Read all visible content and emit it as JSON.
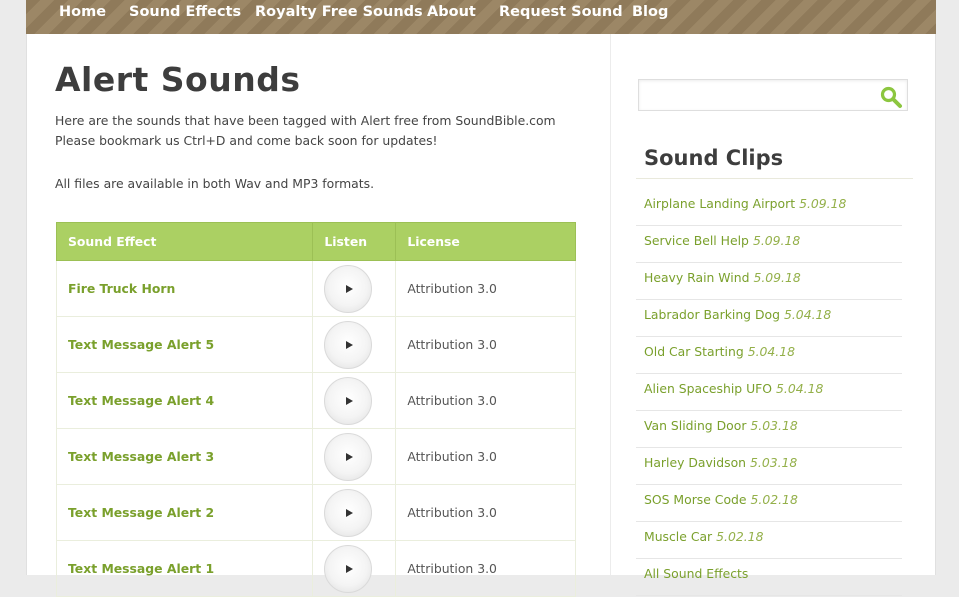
{
  "nav": {
    "items": [
      "Home",
      "Sound Effects",
      "Royalty Free Sounds",
      "About",
      "Request Sound",
      "Blog"
    ]
  },
  "main": {
    "title": "Alert Sounds",
    "intro": "Here are the sounds that have been tagged with Alert free from SoundBible.com Please bookmark us Ctrl+D and come back soon for updates!",
    "formats": "All files are available in both Wav and MP3 formats.",
    "table": {
      "headers": [
        "Sound Effect",
        "Listen",
        "License"
      ],
      "rows": [
        {
          "name": "Fire Truck Horn",
          "license": "Attribution 3.0"
        },
        {
          "name": "Text Message Alert 5",
          "license": "Attribution 3.0"
        },
        {
          "name": "Text Message Alert 4",
          "license": "Attribution 3.0"
        },
        {
          "name": "Text Message Alert 3",
          "license": "Attribution 3.0"
        },
        {
          "name": "Text Message Alert 2",
          "license": "Attribution 3.0"
        },
        {
          "name": "Text Message Alert 1",
          "license": "Attribution 3.0"
        }
      ]
    }
  },
  "sidebar": {
    "search": {
      "value": "",
      "icon": "search-icon",
      "icon_color": "#8cc63f"
    },
    "heading": "Sound Clips",
    "clips": [
      {
        "title": "Airplane Landing Airport",
        "date": "5.09.18"
      },
      {
        "title": "Service Bell Help",
        "date": "5.09.18"
      },
      {
        "title": "Heavy Rain Wind",
        "date": "5.09.18"
      },
      {
        "title": "Labrador Barking Dog",
        "date": "5.04.18"
      },
      {
        "title": "Old Car Starting",
        "date": "5.04.18"
      },
      {
        "title": "Alien Spaceship UFO",
        "date": "5.04.18"
      },
      {
        "title": "Van Sliding Door",
        "date": "5.03.18"
      },
      {
        "title": "Harley Davidson",
        "date": "5.03.18"
      },
      {
        "title": "SOS Morse Code",
        "date": "5.02.18"
      },
      {
        "title": "Muscle Car",
        "date": "5.02.18"
      },
      {
        "title": "All Sound Effects",
        "date": ""
      }
    ]
  },
  "colors": {
    "accent_green": "#abd063",
    "link_green": "#7aa02c",
    "nav_brown": "#8f7a5a"
  }
}
